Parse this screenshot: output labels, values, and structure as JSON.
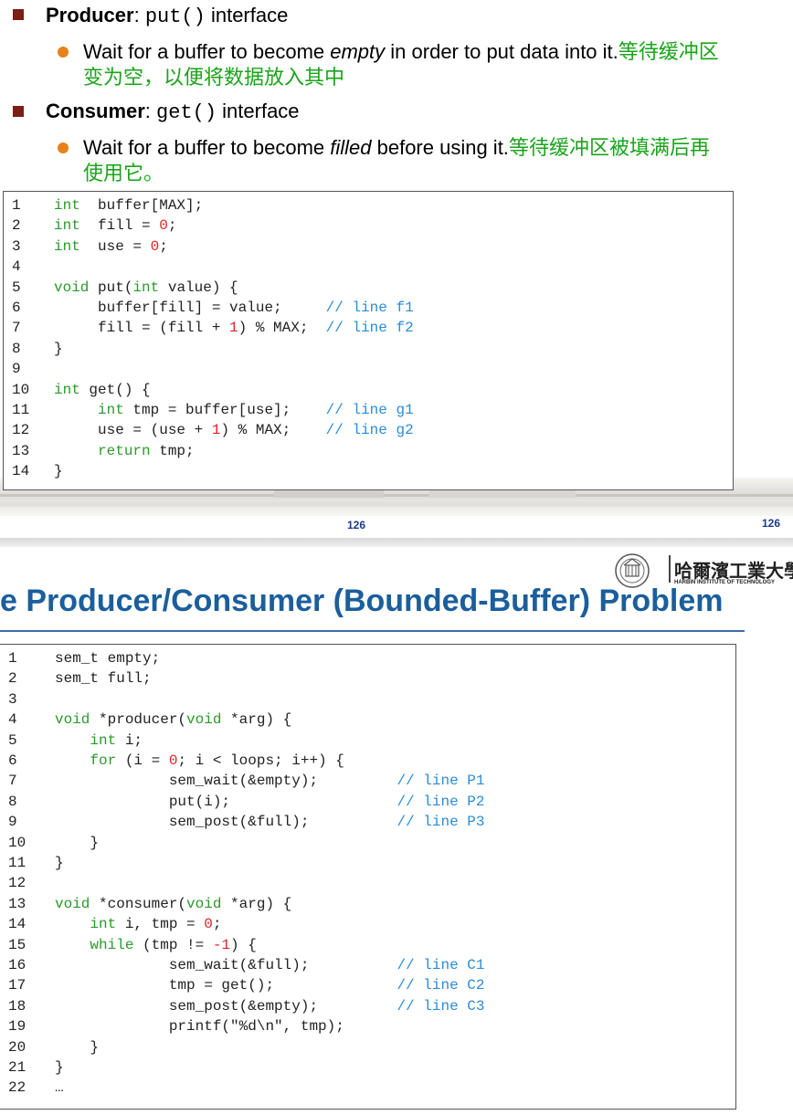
{
  "slide1": {
    "bullets": [
      {
        "bold": "Producer",
        "colon": ": ",
        "code": "put()",
        "after": " interface"
      },
      {
        "bold": "Consumer",
        "colon": ": ",
        "code": "get()",
        "after": " interface"
      }
    ],
    "subbullets": [
      {
        "pre": "Wait for a buffer to become ",
        "em": "empty",
        "post": " in order to put data into it.",
        "cn1": "等待缓冲区",
        "cn2": "变为空，以便将数据放入其中"
      },
      {
        "pre": "Wait for a buffer to become ",
        "em": "filled",
        "post": " before using it.",
        "cn1": "等待缓冲区被填满后再",
        "cn2": "使用它。"
      }
    ],
    "code": [
      {
        "n": "1",
        "t": [
          [
            "kw",
            "int"
          ],
          [
            "",
            "  buffer[MAX];"
          ]
        ]
      },
      {
        "n": "2",
        "t": [
          [
            "kw",
            "int"
          ],
          [
            "",
            "  fill = "
          ],
          [
            "num",
            "0"
          ],
          [
            "",
            ";"
          ]
        ]
      },
      {
        "n": "3",
        "t": [
          [
            "kw",
            "int"
          ],
          [
            "",
            "  use = "
          ],
          [
            "num",
            "0"
          ],
          [
            "",
            ";"
          ]
        ]
      },
      {
        "n": "4",
        "t": []
      },
      {
        "n": "5",
        "t": [
          [
            "kw",
            "void"
          ],
          [
            "",
            " put("
          ],
          [
            "kw",
            "int"
          ],
          [
            "",
            " value) {"
          ]
        ]
      },
      {
        "n": "6",
        "t": [
          [
            "",
            "     buffer[fill] = value;     "
          ],
          [
            "cm",
            "// line f1"
          ]
        ]
      },
      {
        "n": "7",
        "t": [
          [
            "",
            "     fill = (fill + "
          ],
          [
            "num",
            "1"
          ],
          [
            "",
            ") % MAX;  "
          ],
          [
            "cm",
            "// line f2"
          ]
        ]
      },
      {
        "n": "8",
        "t": [
          [
            "",
            "}"
          ]
        ]
      },
      {
        "n": "9",
        "t": []
      },
      {
        "n": "10",
        "t": [
          [
            "kw",
            "int"
          ],
          [
            "",
            " get() {"
          ]
        ]
      },
      {
        "n": "11",
        "t": [
          [
            "",
            "     "
          ],
          [
            "kw",
            "int"
          ],
          [
            "",
            " tmp = buffer[use];    "
          ],
          [
            "cm",
            "// line g1"
          ]
        ]
      },
      {
        "n": "12",
        "t": [
          [
            "",
            "     use = (use + "
          ],
          [
            "num",
            "1"
          ],
          [
            "",
            ") % MAX;    "
          ],
          [
            "cm",
            "// line g2"
          ]
        ]
      },
      {
        "n": "13",
        "t": [
          [
            "",
            "     "
          ],
          [
            "kw",
            "return"
          ],
          [
            "",
            " tmp;"
          ]
        ]
      },
      {
        "n": "14",
        "t": [
          [
            "",
            "}"
          ]
        ]
      }
    ],
    "page_number_center": "126",
    "page_number_right": "126"
  },
  "slide2": {
    "title": "e Producer/Consumer (Bounded-Buffer) Problem",
    "logo_text": "哈爾濱工業大學",
    "logo_sub": "HARBIN INSTITUTE OF TECHNOLOGY",
    "code": [
      {
        "n": "1",
        "t": [
          [
            "",
            "sem_t empty;"
          ]
        ]
      },
      {
        "n": "2",
        "t": [
          [
            "",
            "sem_t full;"
          ]
        ]
      },
      {
        "n": "3",
        "t": []
      },
      {
        "n": "4",
        "t": [
          [
            "kw",
            "void"
          ],
          [
            "",
            " *producer("
          ],
          [
            "kw",
            "void"
          ],
          [
            "",
            " *arg) {"
          ]
        ]
      },
      {
        "n": "5",
        "t": [
          [
            "",
            "    "
          ],
          [
            "kw",
            "int"
          ],
          [
            "",
            " i;"
          ]
        ]
      },
      {
        "n": "6",
        "t": [
          [
            "",
            "    "
          ],
          [
            "kw",
            "for"
          ],
          [
            "",
            " (i = "
          ],
          [
            "num",
            "0"
          ],
          [
            "",
            "; i < loops; i++) {"
          ]
        ]
      },
      {
        "n": "7",
        "t": [
          [
            "",
            "             sem_wait(&empty);         "
          ],
          [
            "cm",
            "// line P1"
          ]
        ]
      },
      {
        "n": "8",
        "t": [
          [
            "",
            "             put(i);                   "
          ],
          [
            "cm",
            "// line P2"
          ]
        ]
      },
      {
        "n": "9",
        "t": [
          [
            "",
            "             sem_post(&full);          "
          ],
          [
            "cm",
            "// line P3"
          ]
        ]
      },
      {
        "n": "10",
        "t": [
          [
            "",
            "    }"
          ]
        ]
      },
      {
        "n": "11",
        "t": [
          [
            "",
            "}"
          ]
        ]
      },
      {
        "n": "12",
        "t": []
      },
      {
        "n": "13",
        "t": [
          [
            "kw",
            "void"
          ],
          [
            "",
            " *consumer("
          ],
          [
            "kw",
            "void"
          ],
          [
            "",
            " *arg) {"
          ]
        ]
      },
      {
        "n": "14",
        "t": [
          [
            "",
            "    "
          ],
          [
            "kw",
            "int"
          ],
          [
            "",
            " i, tmp = "
          ],
          [
            "num",
            "0"
          ],
          [
            "",
            ";"
          ]
        ]
      },
      {
        "n": "15",
        "t": [
          [
            "",
            "    "
          ],
          [
            "kw",
            "while"
          ],
          [
            "",
            " (tmp != "
          ],
          [
            "num",
            "-1"
          ],
          [
            "",
            ") {"
          ]
        ]
      },
      {
        "n": "16",
        "t": [
          [
            "",
            "             sem_wait(&full);          "
          ],
          [
            "cm",
            "// line C1"
          ]
        ]
      },
      {
        "n": "17",
        "t": [
          [
            "",
            "             tmp = get();              "
          ],
          [
            "cm",
            "// line C2"
          ]
        ]
      },
      {
        "n": "18",
        "t": [
          [
            "",
            "             sem_post(&empty);         "
          ],
          [
            "cm",
            "// line C3"
          ]
        ]
      },
      {
        "n": "19",
        "t": [
          [
            "",
            "             printf(\"%d\\n\", tmp);"
          ]
        ]
      },
      {
        "n": "20",
        "t": [
          [
            "",
            "    }"
          ]
        ]
      },
      {
        "n": "21",
        "t": [
          [
            "",
            "}"
          ]
        ]
      },
      {
        "n": "22",
        "t": [
          [
            "",
            "…"
          ]
        ]
      }
    ]
  }
}
